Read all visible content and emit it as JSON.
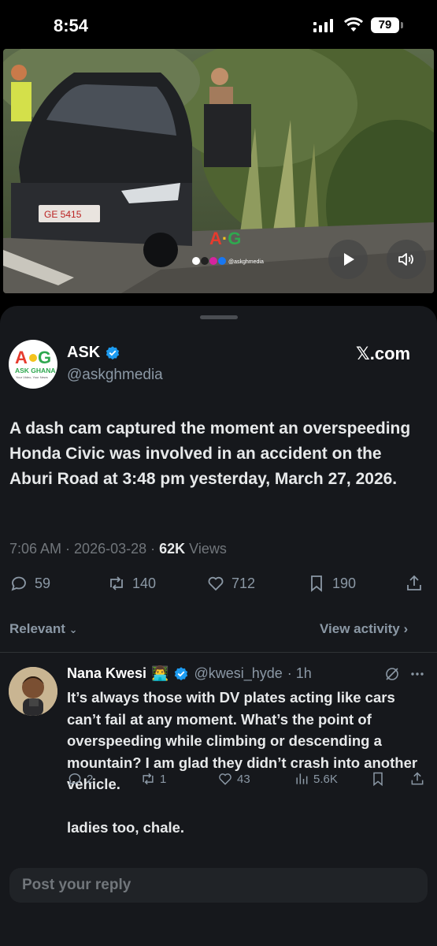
{
  "status_bar": {
    "time": "8:54",
    "battery": "79"
  },
  "media": {
    "plate_text": "GE 5415",
    "watermark": "A G",
    "watermark_social": "@askghmedia"
  },
  "post": {
    "author_name": "ASK",
    "author_handle": "@askghmedia",
    "avatar_text": "ASK GHANA",
    "avatar_tagline": "Your Video, Your News",
    "source": "𝕏.com",
    "text": "A dash cam captured the moment an overspeeding Honda Civic was involved in an accident on the Aburi Road at 3:48 pm yesterday, March 27, 2026.",
    "time": "7:06 AM",
    "date": "2026-03-28",
    "views_count": "62K",
    "views_label": "Views",
    "replies": "59",
    "reposts": "140",
    "likes": "712",
    "bookmarks": "190"
  },
  "filters": {
    "relevant": "Relevant",
    "view_activity": "View activity"
  },
  "reply": {
    "name": "Nana Kwesi",
    "emoji": "👨‍💻",
    "handle": "@kwesi_hyde",
    "age": "· 1h",
    "text": "It’s always those with DV plates acting like cars can’t fail at any moment. What’s the point of overspeeding while climbing or descending a mountain? I am glad  they didn’t crash into another vehicle.\n\nladies too, chale.",
    "replies": "2",
    "reposts": "1",
    "likes": "43",
    "views": "5.6K"
  },
  "composer": {
    "placeholder": "Post your reply"
  },
  "colors": {
    "accent": "#1d9bf0",
    "background": "#16181c",
    "muted": "#8b98a5"
  }
}
